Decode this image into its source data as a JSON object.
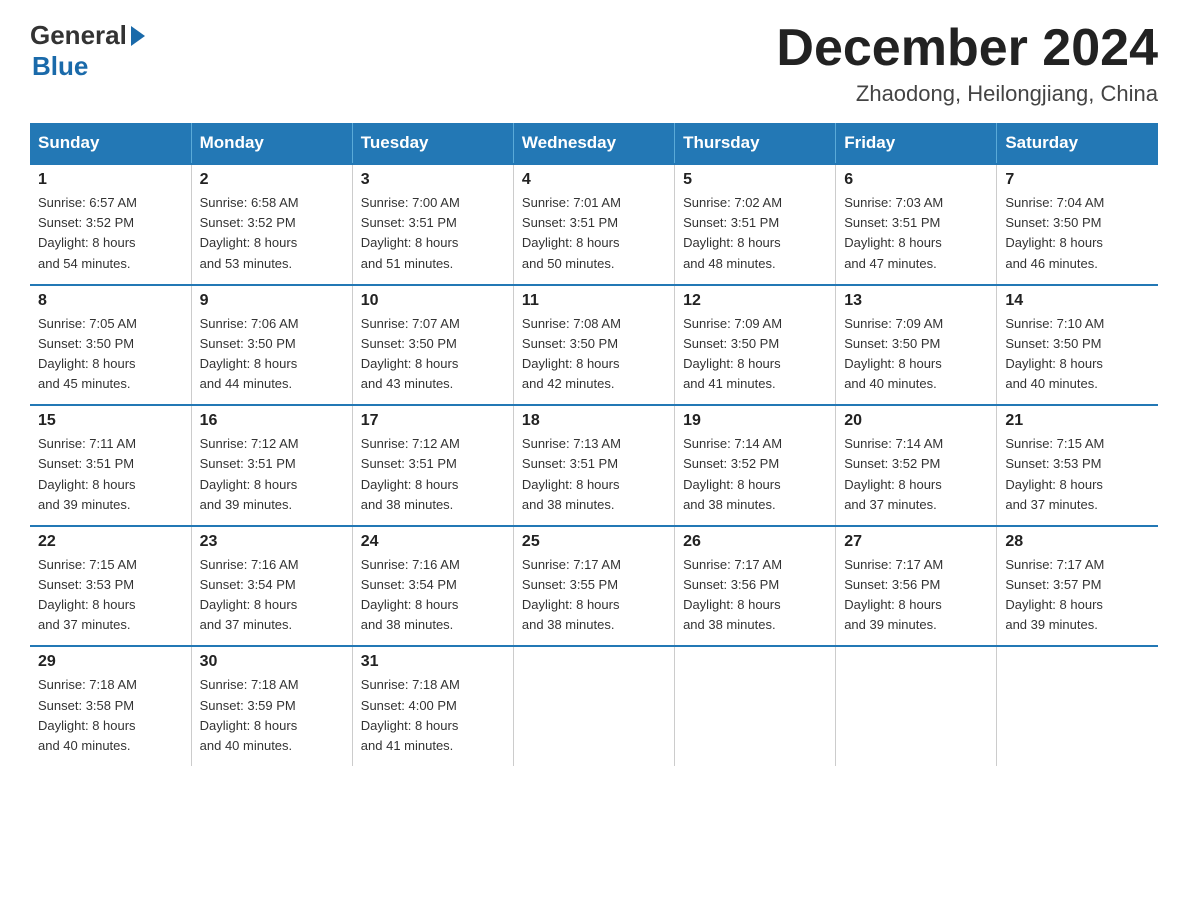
{
  "logo": {
    "general": "General",
    "blue": "Blue"
  },
  "header": {
    "month": "December 2024",
    "location": "Zhaodong, Heilongjiang, China"
  },
  "weekdays": [
    "Sunday",
    "Monday",
    "Tuesday",
    "Wednesday",
    "Thursday",
    "Friday",
    "Saturday"
  ],
  "weeks": [
    [
      {
        "day": "1",
        "sunrise": "6:57 AM",
        "sunset": "3:52 PM",
        "daylight": "8 hours and 54 minutes."
      },
      {
        "day": "2",
        "sunrise": "6:58 AM",
        "sunset": "3:52 PM",
        "daylight": "8 hours and 53 minutes."
      },
      {
        "day": "3",
        "sunrise": "7:00 AM",
        "sunset": "3:51 PM",
        "daylight": "8 hours and 51 minutes."
      },
      {
        "day": "4",
        "sunrise": "7:01 AM",
        "sunset": "3:51 PM",
        "daylight": "8 hours and 50 minutes."
      },
      {
        "day": "5",
        "sunrise": "7:02 AM",
        "sunset": "3:51 PM",
        "daylight": "8 hours and 48 minutes."
      },
      {
        "day": "6",
        "sunrise": "7:03 AM",
        "sunset": "3:51 PM",
        "daylight": "8 hours and 47 minutes."
      },
      {
        "day": "7",
        "sunrise": "7:04 AM",
        "sunset": "3:50 PM",
        "daylight": "8 hours and 46 minutes."
      }
    ],
    [
      {
        "day": "8",
        "sunrise": "7:05 AM",
        "sunset": "3:50 PM",
        "daylight": "8 hours and 45 minutes."
      },
      {
        "day": "9",
        "sunrise": "7:06 AM",
        "sunset": "3:50 PM",
        "daylight": "8 hours and 44 minutes."
      },
      {
        "day": "10",
        "sunrise": "7:07 AM",
        "sunset": "3:50 PM",
        "daylight": "8 hours and 43 minutes."
      },
      {
        "day": "11",
        "sunrise": "7:08 AM",
        "sunset": "3:50 PM",
        "daylight": "8 hours and 42 minutes."
      },
      {
        "day": "12",
        "sunrise": "7:09 AM",
        "sunset": "3:50 PM",
        "daylight": "8 hours and 41 minutes."
      },
      {
        "day": "13",
        "sunrise": "7:09 AM",
        "sunset": "3:50 PM",
        "daylight": "8 hours and 40 minutes."
      },
      {
        "day": "14",
        "sunrise": "7:10 AM",
        "sunset": "3:50 PM",
        "daylight": "8 hours and 40 minutes."
      }
    ],
    [
      {
        "day": "15",
        "sunrise": "7:11 AM",
        "sunset": "3:51 PM",
        "daylight": "8 hours and 39 minutes."
      },
      {
        "day": "16",
        "sunrise": "7:12 AM",
        "sunset": "3:51 PM",
        "daylight": "8 hours and 39 minutes."
      },
      {
        "day": "17",
        "sunrise": "7:12 AM",
        "sunset": "3:51 PM",
        "daylight": "8 hours and 38 minutes."
      },
      {
        "day": "18",
        "sunrise": "7:13 AM",
        "sunset": "3:51 PM",
        "daylight": "8 hours and 38 minutes."
      },
      {
        "day": "19",
        "sunrise": "7:14 AM",
        "sunset": "3:52 PM",
        "daylight": "8 hours and 38 minutes."
      },
      {
        "day": "20",
        "sunrise": "7:14 AM",
        "sunset": "3:52 PM",
        "daylight": "8 hours and 37 minutes."
      },
      {
        "day": "21",
        "sunrise": "7:15 AM",
        "sunset": "3:53 PM",
        "daylight": "8 hours and 37 minutes."
      }
    ],
    [
      {
        "day": "22",
        "sunrise": "7:15 AM",
        "sunset": "3:53 PM",
        "daylight": "8 hours and 37 minutes."
      },
      {
        "day": "23",
        "sunrise": "7:16 AM",
        "sunset": "3:54 PM",
        "daylight": "8 hours and 37 minutes."
      },
      {
        "day": "24",
        "sunrise": "7:16 AM",
        "sunset": "3:54 PM",
        "daylight": "8 hours and 38 minutes."
      },
      {
        "day": "25",
        "sunrise": "7:17 AM",
        "sunset": "3:55 PM",
        "daylight": "8 hours and 38 minutes."
      },
      {
        "day": "26",
        "sunrise": "7:17 AM",
        "sunset": "3:56 PM",
        "daylight": "8 hours and 38 minutes."
      },
      {
        "day": "27",
        "sunrise": "7:17 AM",
        "sunset": "3:56 PM",
        "daylight": "8 hours and 39 minutes."
      },
      {
        "day": "28",
        "sunrise": "7:17 AM",
        "sunset": "3:57 PM",
        "daylight": "8 hours and 39 minutes."
      }
    ],
    [
      {
        "day": "29",
        "sunrise": "7:18 AM",
        "sunset": "3:58 PM",
        "daylight": "8 hours and 40 minutes."
      },
      {
        "day": "30",
        "sunrise": "7:18 AM",
        "sunset": "3:59 PM",
        "daylight": "8 hours and 40 minutes."
      },
      {
        "day": "31",
        "sunrise": "7:18 AM",
        "sunset": "4:00 PM",
        "daylight": "8 hours and 41 minutes."
      },
      null,
      null,
      null,
      null
    ]
  ],
  "labels": {
    "sunrise": "Sunrise:",
    "sunset": "Sunset:",
    "daylight": "Daylight:"
  }
}
